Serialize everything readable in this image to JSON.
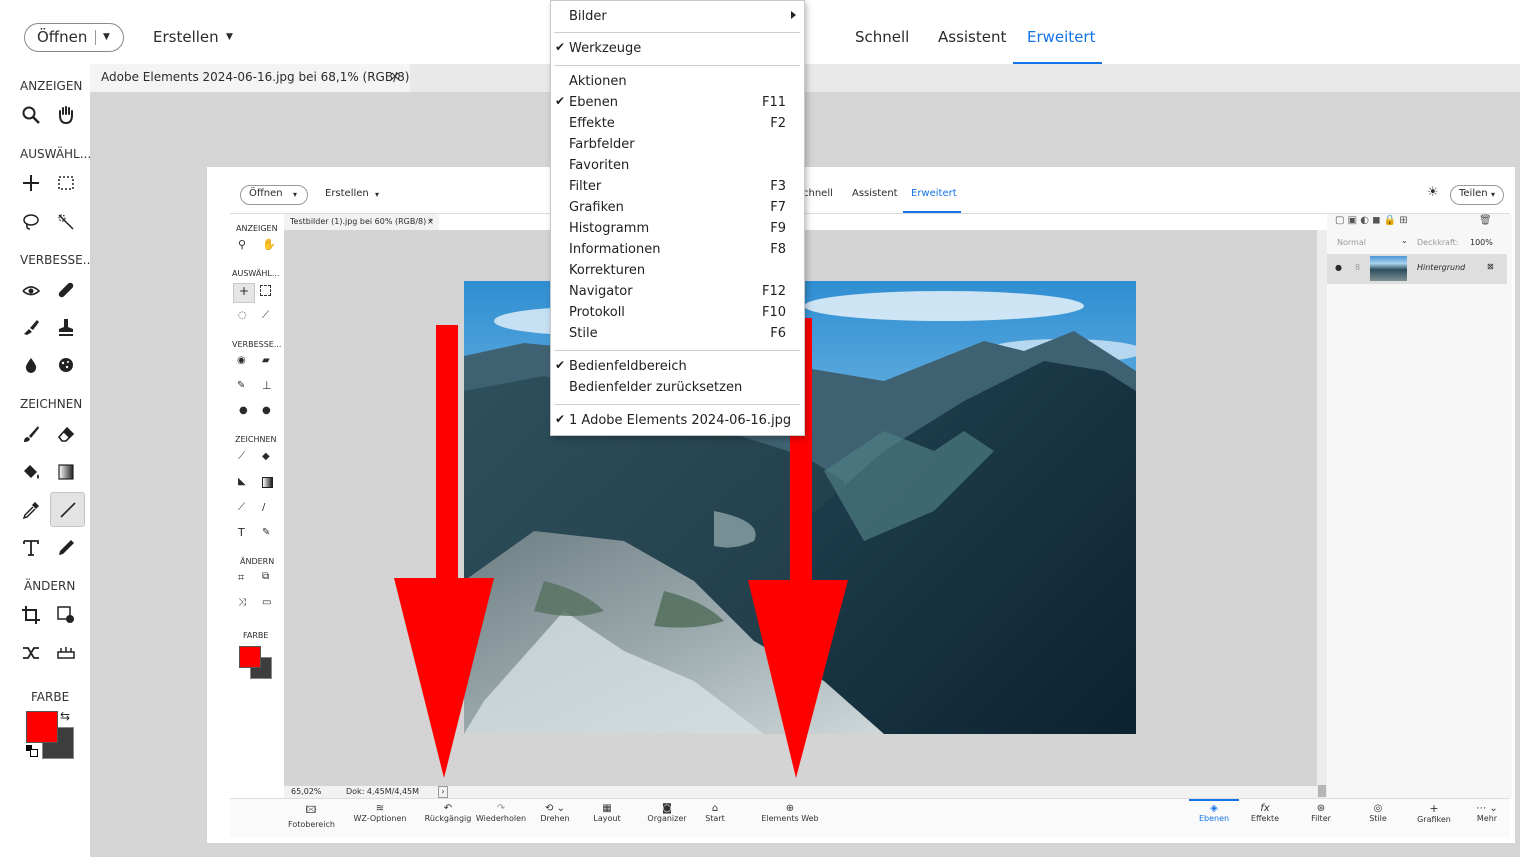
{
  "topbar": {
    "open_label": "Öffnen",
    "create_label": "Erstellen",
    "modes": [
      "Schnell",
      "Assistent",
      "Erweitert"
    ],
    "active_mode": "Erweitert",
    "accent": "#1473e6"
  },
  "document_tab": {
    "title": "Adobe Elements 2024-06-16.jpg bei 68,1% (RGB/8)",
    "close": "×"
  },
  "left_toolbar": {
    "sections": {
      "view": "ANZEIGEN",
      "select": "AUSWÄHL...",
      "enhance": "VERBESSE...",
      "draw": "ZEICHNEN",
      "modify": "ÄNDERN",
      "color": "FARBE"
    },
    "foreground_color": "#ff0000",
    "background_color": "#3d3d3d"
  },
  "menu": {
    "items": [
      {
        "label": "Bilder",
        "shortcut": "",
        "checked": false,
        "submenu": true
      },
      {
        "label": "Werkzeuge",
        "shortcut": "",
        "checked": true
      },
      {
        "label": "Aktionen",
        "shortcut": "",
        "checked": false
      },
      {
        "label": "Ebenen",
        "shortcut": "F11",
        "checked": true
      },
      {
        "label": "Effekte",
        "shortcut": "F2",
        "checked": false
      },
      {
        "label": "Farbfelder",
        "shortcut": "",
        "checked": false
      },
      {
        "label": "Favoriten",
        "shortcut": "",
        "checked": false
      },
      {
        "label": "Filter",
        "shortcut": "F3",
        "checked": false
      },
      {
        "label": "Grafiken",
        "shortcut": "F7",
        "checked": false
      },
      {
        "label": "Histogramm",
        "shortcut": "F9",
        "checked": false
      },
      {
        "label": "Informationen",
        "shortcut": "F8",
        "checked": false
      },
      {
        "label": "Korrekturen",
        "shortcut": "",
        "checked": false
      },
      {
        "label": "Navigator",
        "shortcut": "F12",
        "checked": false
      },
      {
        "label": "Protokoll",
        "shortcut": "F10",
        "checked": false
      },
      {
        "label": "Stile",
        "shortcut": "F6",
        "checked": false
      },
      {
        "label": "Bedienfeldbereich",
        "shortcut": "",
        "checked": true
      },
      {
        "label": "Bedienfelder zurücksetzen",
        "shortcut": "",
        "checked": false
      },
      {
        "label": "1 Adobe Elements 2024-06-16.jpg",
        "shortcut": "",
        "checked": true
      }
    ],
    "check_mark": "✔"
  },
  "inner": {
    "open_label": "Öffnen",
    "create_label": "Erstellen",
    "modes": [
      "chnell",
      "Assistent",
      "Erweitert"
    ],
    "share_label": "Teilen",
    "tab_title": "Testbilder (1).jpg bei 60% (RGB/8) *",
    "sections": [
      "ANZEIGEN",
      "AUSWÄHL...",
      "VERBESSE...",
      "ZEICHNEN",
      "ÄNDERN",
      "FARBE"
    ],
    "blend_mode": "Normal",
    "opacity_label": "Deckkraft:",
    "opacity_value": "100%",
    "layer_name": "Hintergrund",
    "zoom": "65,02%",
    "doc_info": "Dok: 4,45M/4,45M",
    "bottom_left": [
      "Fotobereich",
      "WZ-Optionen",
      "Rückgängig",
      "Wiederholen",
      "Drehen",
      "Layout",
      "Organizer",
      "Start",
      "Elements Web"
    ],
    "bottom_right": [
      "Ebenen",
      "Effekte",
      "Filter",
      "Stile",
      "Grafiken",
      "Mehr"
    ]
  },
  "annotation_color": "#ff0000"
}
